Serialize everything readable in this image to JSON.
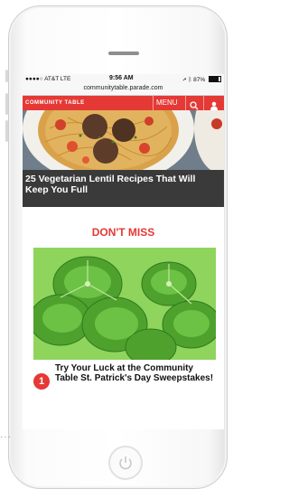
{
  "status_bar": {
    "carrier": "●●●●○ AT&T  LTE",
    "time": "9:56 AM",
    "battery": "87%",
    "battery_level": 0.87
  },
  "url": "communitytable.parade.com",
  "nav": {
    "logo": "COMMUNITY TABLE",
    "menu_label": "MENU",
    "icons": [
      "search-icon",
      "user-icon"
    ]
  },
  "hero": {
    "title": "25 Vegetarian Lentil Recipes That Will Keep You Full"
  },
  "section": {
    "heading": "DON'T MISS"
  },
  "featured": {
    "number": "1",
    "title": "Try Your Luck at the Community Table St. Patrick's Day Sweepstakes!"
  },
  "colors": {
    "accent": "#e53935",
    "hero_bg": "#3a3a3a",
    "clover": "#5fb437"
  }
}
